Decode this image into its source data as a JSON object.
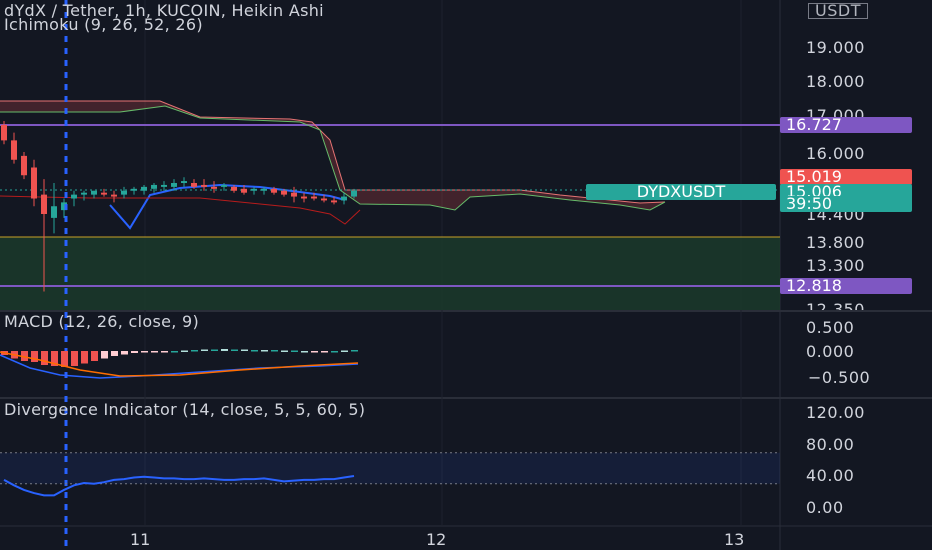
{
  "header": {
    "title": "dYdX / Tether, 1h, KUCOIN, Heikin Ashi",
    "ichimoku": "Ichimoku (9, 26, 52, 26)"
  },
  "currency_label": "USDT",
  "price_axis": {
    "ticks": [
      "19.000",
      "18.000",
      "17.000",
      "16.000",
      "14.400",
      "13.800",
      "13.300",
      "12.350"
    ]
  },
  "price_labels": {
    "purple_top": "16.727",
    "red": "15.019",
    "symbol": "DYDXUSDT",
    "last": "15.006",
    "countdown": "39:50",
    "purple_bottom": "12.818"
  },
  "macd": {
    "title": "MACD (12, 26, close, 9)",
    "ticks": [
      "0.500",
      "0.000",
      "−0.500"
    ]
  },
  "divergence": {
    "title": "Divergence Indicator (14, close, 5, 5, 60, 5)",
    "ticks": [
      "120.00",
      "80.00",
      "40.00",
      "0.00"
    ]
  },
  "time_axis": {
    "ticks": [
      "11",
      "12",
      "13"
    ]
  },
  "colors": {
    "background": "#131722",
    "up": "#26a69a",
    "down": "#ef5350",
    "purple": "#7e57c2",
    "blue": "#2962ff",
    "cloud_green": "#1b3a2a"
  },
  "chart_data": {
    "type": "candlestick",
    "candles": [
      {
        "o": 16.7,
        "h": 16.8,
        "l": 16.2,
        "c": 16.3
      },
      {
        "o": 16.3,
        "h": 16.5,
        "l": 15.7,
        "c": 15.8
      },
      {
        "o": 15.9,
        "h": 16.0,
        "l": 15.3,
        "c": 15.4
      },
      {
        "o": 15.6,
        "h": 15.8,
        "l": 14.6,
        "c": 14.8
      },
      {
        "o": 14.9,
        "h": 15.3,
        "l": 12.4,
        "c": 14.4
      },
      {
        "o": 14.3,
        "h": 15.2,
        "l": 13.9,
        "c": 14.6
      },
      {
        "o": 14.5,
        "h": 14.8,
        "l": 14.3,
        "c": 14.7
      },
      {
        "o": 14.8,
        "h": 15.0,
        "l": 14.6,
        "c": 14.9
      },
      {
        "o": 14.9,
        "h": 15.0,
        "l": 14.75,
        "c": 14.95
      },
      {
        "o": 14.9,
        "h": 15.0,
        "l": 14.8,
        "c": 15.0
      },
      {
        "o": 14.95,
        "h": 15.05,
        "l": 14.85,
        "c": 14.9
      },
      {
        "o": 14.9,
        "h": 15.0,
        "l": 14.7,
        "c": 14.85
      },
      {
        "o": 14.9,
        "h": 15.1,
        "l": 14.8,
        "c": 15.0
      },
      {
        "o": 15.0,
        "h": 15.1,
        "l": 14.9,
        "c": 15.05
      },
      {
        "o": 15.0,
        "h": 15.15,
        "l": 14.9,
        "c": 15.1
      },
      {
        "o": 15.05,
        "h": 15.2,
        "l": 14.95,
        "c": 15.15
      },
      {
        "o": 15.1,
        "h": 15.25,
        "l": 15.0,
        "c": 15.15
      },
      {
        "o": 15.1,
        "h": 15.3,
        "l": 15.0,
        "c": 15.2
      },
      {
        "o": 15.2,
        "h": 15.35,
        "l": 15.1,
        "c": 15.25
      },
      {
        "o": 15.2,
        "h": 15.3,
        "l": 15.05,
        "c": 15.1
      },
      {
        "o": 15.15,
        "h": 15.3,
        "l": 15.0,
        "c": 15.1
      },
      {
        "o": 15.1,
        "h": 15.25,
        "l": 14.95,
        "c": 15.05
      },
      {
        "o": 15.1,
        "h": 15.2,
        "l": 15.0,
        "c": 15.15
      },
      {
        "o": 15.1,
        "h": 15.15,
        "l": 14.95,
        "c": 15.0
      },
      {
        "o": 15.05,
        "h": 15.15,
        "l": 14.9,
        "c": 14.95
      },
      {
        "o": 15.0,
        "h": 15.1,
        "l": 14.9,
        "c": 15.05
      },
      {
        "o": 15.0,
        "h": 15.1,
        "l": 14.9,
        "c": 15.05
      },
      {
        "o": 15.05,
        "h": 15.1,
        "l": 14.9,
        "c": 14.95
      },
      {
        "o": 15.0,
        "h": 15.05,
        "l": 14.85,
        "c": 14.9
      },
      {
        "o": 14.95,
        "h": 15.1,
        "l": 14.7,
        "c": 14.85
      },
      {
        "o": 14.85,
        "h": 14.95,
        "l": 14.7,
        "c": 14.8
      },
      {
        "o": 14.85,
        "h": 14.95,
        "l": 14.75,
        "c": 14.8
      },
      {
        "o": 14.8,
        "h": 14.9,
        "l": 14.7,
        "c": 14.75
      },
      {
        "o": 14.75,
        "h": 14.85,
        "l": 14.65,
        "c": 14.7
      },
      {
        "o": 14.75,
        "h": 14.95,
        "l": 14.65,
        "c": 14.85
      },
      {
        "o": 14.85,
        "h": 15.05,
        "l": 14.8,
        "c": 15.0
      }
    ],
    "macd_histogram": [
      -0.08,
      -0.15,
      -0.2,
      -0.22,
      -0.28,
      -0.3,
      -0.32,
      -0.3,
      -0.25,
      -0.2,
      -0.15,
      -0.1,
      -0.07,
      -0.04,
      -0.03,
      -0.02,
      -0.01,
      0.0,
      0.01,
      0.02,
      0.03,
      0.03,
      0.04,
      0.03,
      0.03,
      0.02,
      0.02,
      0.02,
      0.01,
      0.01,
      0.0,
      -0.01,
      -0.01,
      0.0,
      0.01,
      0.02
    ],
    "divergence_line": [
      35,
      28,
      22,
      18,
      15,
      15,
      22,
      28,
      31,
      30,
      32,
      35,
      36,
      38,
      39,
      38,
      37,
      37,
      36,
      36,
      37,
      36,
      35,
      35,
      36,
      36,
      37,
      35,
      33,
      34,
      35,
      35,
      36,
      36,
      38,
      40
    ]
  }
}
